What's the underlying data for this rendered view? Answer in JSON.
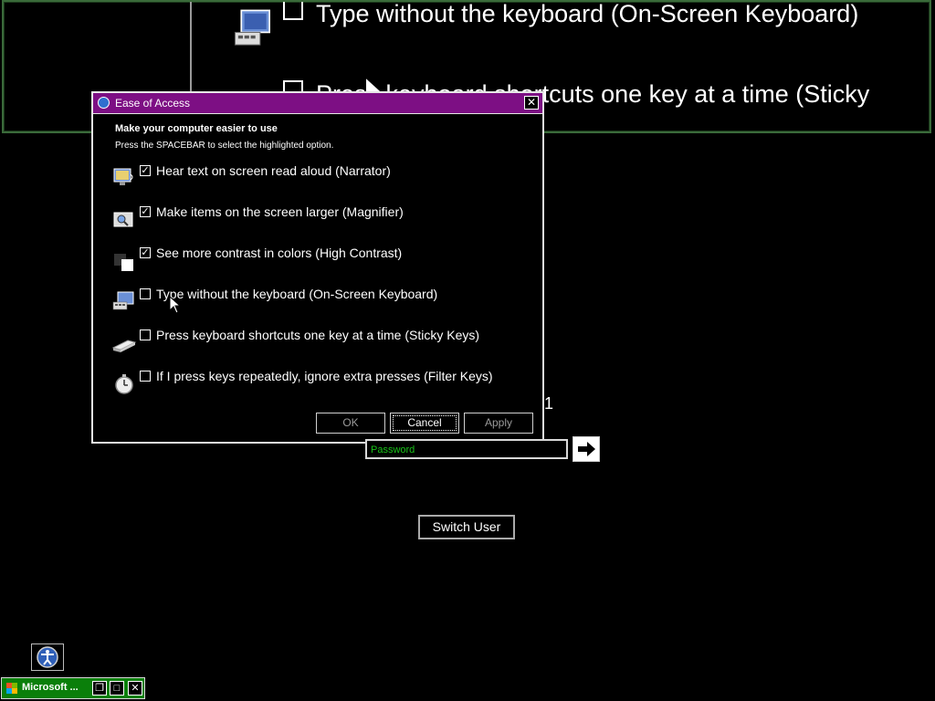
{
  "magnifier_view": {
    "row1_text": "Type without the keyboard (On-Screen Keyboard)",
    "row2_text": "Press keyboard shortcuts one key at a time (Sticky"
  },
  "dialog": {
    "title": "Ease of Access",
    "close_glyph": "✕",
    "heading": "Make your computer easier to use",
    "subheading": "Press the SPACEBAR to select the highlighted option.",
    "options": [
      {
        "icon": "narrator-icon",
        "checked": true,
        "label": "Hear text on screen read aloud (Narrator)"
      },
      {
        "icon": "magnifier-icon",
        "checked": true,
        "label": "Make items on the screen larger (Magnifier)"
      },
      {
        "icon": "high-contrast-icon",
        "checked": true,
        "label": "See more contrast in colors (High Contrast)"
      },
      {
        "icon": "keyboard-icon",
        "checked": false,
        "label": "Type without the keyboard (On-Screen Keyboard)"
      },
      {
        "icon": "sticky-keys-icon",
        "checked": false,
        "label": "Press keyboard shortcuts one key at a time (Sticky Keys)"
      },
      {
        "icon": "stopwatch-icon",
        "checked": false,
        "label": "If I press keys repeatedly, ignore extra presses (Filter Keys)"
      }
    ],
    "buttons": {
      "ok": "OK",
      "cancel": "Cancel",
      "apply": "Apply"
    },
    "focused_button": "cancel"
  },
  "logon": {
    "password_placeholder": "Password",
    "stray_char": "1",
    "switch_user": "Switch User"
  },
  "taskbar": {
    "item_label": "Microsoft ..."
  },
  "colors": {
    "title_bar": "#7d0f84",
    "password_text": "#18c218",
    "taskbar_item": "#0a7f0a",
    "magnifier_border": "#3a6a3a"
  }
}
